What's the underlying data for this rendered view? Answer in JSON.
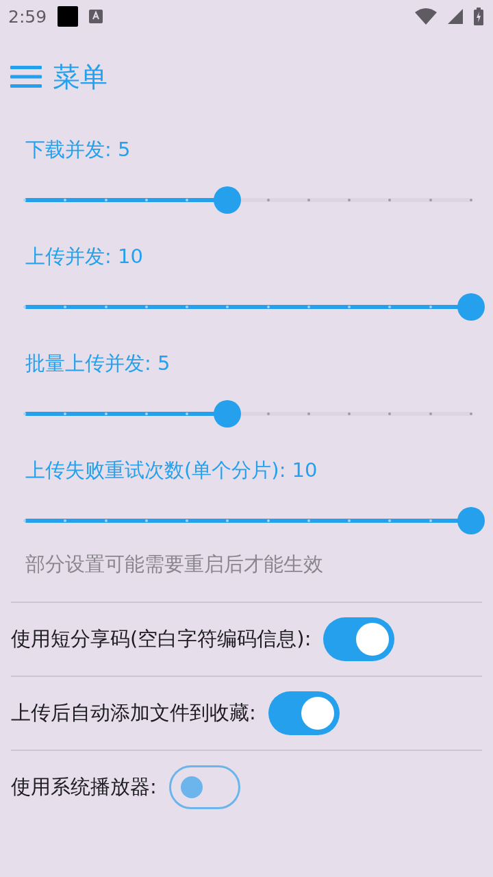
{
  "status_bar": {
    "time": "2:59"
  },
  "header": {
    "title": "菜单"
  },
  "sliders": [
    {
      "label": "下载并发: 5",
      "level": 0.4545
    },
    {
      "label": "上传并发: 10",
      "level": 1
    },
    {
      "label": "批量上传并发: 5",
      "level": 0.4545
    },
    {
      "label": "上传失败重试次数(单个分片): 10",
      "level": 1
    }
  ],
  "note": "部分设置可能需要重启后才能生效",
  "toggles": [
    {
      "label": "使用短分享码(空白字符编码信息):",
      "on": true
    },
    {
      "label": "上传后自动添加文件到收藏:",
      "on": true
    },
    {
      "label": "使用系统播放器:",
      "on": false
    }
  ]
}
